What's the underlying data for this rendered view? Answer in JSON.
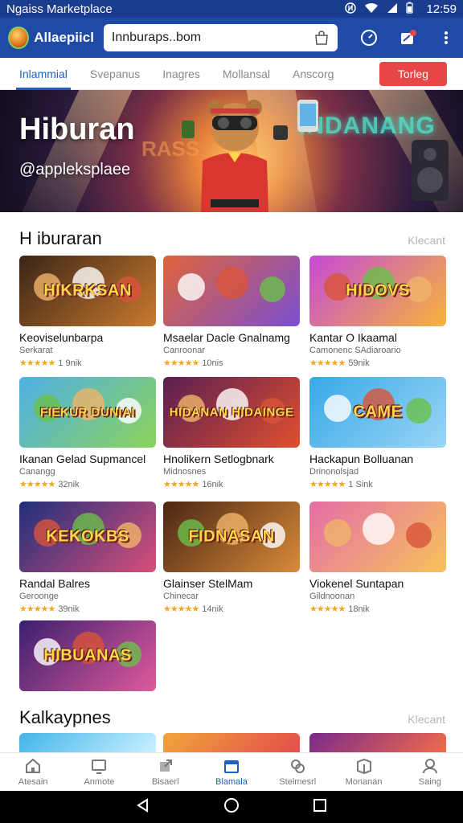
{
  "status_bar": {
    "title": "Ngaiss Marketplace",
    "time": "12:59"
  },
  "app_bar": {
    "app_name": "Allaepiicl",
    "url": "Innburaps..bom",
    "icons": [
      "compass-icon",
      "notification-icon",
      "more-vertical-icon"
    ]
  },
  "tabs": {
    "items": [
      "Inlammial",
      "Svepanus",
      "Inagres",
      "Mollansal",
      "Anscorg"
    ],
    "active": "Inlammial",
    "cta": "Torleg"
  },
  "hero": {
    "title": "Hiburan",
    "handle": "@appleksplaee",
    "neon_sign": "INDANANG",
    "neon_sign_left": "RASS"
  },
  "section1": {
    "title": "H iburaran",
    "more": "Klecant"
  },
  "section2": {
    "title": "Kalkaypnes",
    "more": "Klecant"
  },
  "cards": [
    {
      "title": "Keoviselunbarpa",
      "subtitle": "Serkarat",
      "rating": "1 9nik",
      "thumb_text": "HIKRKSAN",
      "colors": [
        "#3b2516",
        "#c97a2f"
      ]
    },
    {
      "title": "Msaelar Dacle Gnalnamg",
      "subtitle": "Canroonar",
      "rating": "10nis",
      "thumb_text": "",
      "colors": [
        "#e0643a",
        "#7b4fd1"
      ]
    },
    {
      "title": "Kantar O Ikaamal",
      "subtitle": "Camonenc SAdiaroario",
      "rating": "59nik",
      "thumb_text": "HIDOVS",
      "colors": [
        "#c54ad8",
        "#f6b43a"
      ]
    },
    {
      "title": "Ikanan Gelad Supmancel",
      "subtitle": "Canangg",
      "rating": "32nik",
      "thumb_text": "FIEKUR DUNIAI",
      "colors": [
        "#4fb0e6",
        "#8bd25a"
      ]
    },
    {
      "title": "Hnolikern Setlogbnark",
      "subtitle": "Midnosnes",
      "rating": "16nik",
      "thumb_text": "HIDANAN HIDAINGE",
      "colors": [
        "#5a1f52",
        "#e04f2e"
      ]
    },
    {
      "title": "Hackapun Bolluanan",
      "subtitle": "Drinonolsjad",
      "rating": "1 Sink",
      "thumb_text": "CAME",
      "colors": [
        "#38a9e8",
        "#9ad5f5"
      ]
    },
    {
      "title": "Randal Balres",
      "subtitle": "Geroonge",
      "rating": "39nik",
      "thumb_text": "KEKOKBS",
      "colors": [
        "#1f2f7a",
        "#d94f7a"
      ]
    },
    {
      "title": "Glainser StelMam",
      "subtitle": "Chinecar",
      "rating": "14nik",
      "thumb_text": "FIDNASAN",
      "colors": [
        "#4a2614",
        "#d98b3a"
      ]
    },
    {
      "title": "Viokenel Suntapan",
      "subtitle": "Gildnoonan",
      "rating": "18nik",
      "thumb_text": "",
      "colors": [
        "#e46da8",
        "#f7c25a"
      ]
    },
    {
      "title": "",
      "subtitle": "",
      "rating": "",
      "thumb_text": "HIBUANAS",
      "colors": [
        "#3a1f6e",
        "#e05a9c"
      ]
    }
  ],
  "cards2": [
    {
      "colors": [
        "#43b6ea",
        "#c8f0ff"
      ]
    },
    {
      "colors": [
        "#f0a53a",
        "#e54e4e"
      ]
    },
    {
      "colors": [
        "#7a2a8c",
        "#f06b4a"
      ]
    }
  ],
  "bottom_nav": [
    {
      "label": "Atesain",
      "icon": "home-icon"
    },
    {
      "label": "Anmote",
      "icon": "tv-icon"
    },
    {
      "label": "Bisaerl",
      "icon": "share-arrow-icon"
    },
    {
      "label": "Blamala",
      "icon": "calendar-icon"
    },
    {
      "label": "Stelmesrl",
      "icon": "gamepad-icon"
    },
    {
      "label": "Monanan",
      "icon": "box-icon"
    },
    {
      "label": "Saing",
      "icon": "profile-icon"
    }
  ],
  "bottom_nav_active": "Blamala"
}
